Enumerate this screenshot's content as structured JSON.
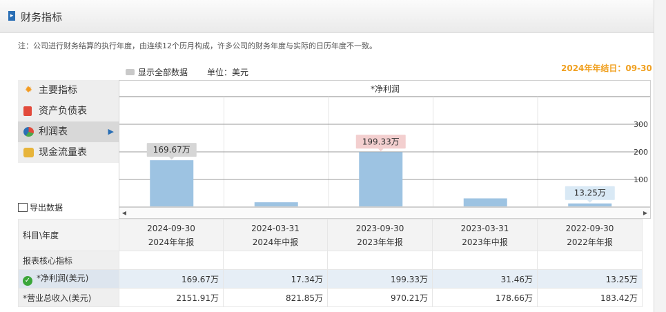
{
  "header": {
    "marker": "▸",
    "title": "财务指标"
  },
  "note": "注：公司进行财务结算的执行年度，由连续12个历月构成，许多公司的财务年度与实际的日历年度不一致。",
  "toolbar": {
    "toggle_label": "显示全部数据",
    "unit_label": "单位：美元",
    "year_end": "2024年年结日：09-30"
  },
  "sidebar": {
    "items": [
      {
        "label": "主要指标",
        "icon": "gear-icon"
      },
      {
        "label": "资产负债表",
        "icon": "document-icon"
      },
      {
        "label": "利润表",
        "icon": "pie-chart-icon"
      },
      {
        "label": "现金流量表",
        "icon": "coins-icon"
      }
    ],
    "export_label": "导出数据"
  },
  "chart_data": {
    "type": "bar",
    "title": "*净利润",
    "categories": [
      "2024-09-30",
      "2024-03-31",
      "2023-09-30",
      "2023-03-31",
      "2022-09-30"
    ],
    "values": [
      169.67,
      17.34,
      199.33,
      31.46,
      13.25
    ],
    "value_unit": "万",
    "ylim": [
      0,
      400
    ],
    "yticks": [
      "100",
      "200",
      "300"
    ],
    "callouts": [
      "169.67万",
      "",
      "199.33万",
      "",
      "13.25万"
    ],
    "callout_colors": [
      "#d6d6d6",
      "",
      "#f3cfcf",
      "",
      "#d9e9f5"
    ],
    "bar_color": "#9dc3e2",
    "grid": true
  },
  "table": {
    "corner": "科目\\年度",
    "columns": [
      {
        "date": "2024-09-30",
        "type": "2024年年报"
      },
      {
        "date": "2024-03-31",
        "type": "2024年中报"
      },
      {
        "date": "2023-09-30",
        "type": "2023年年报"
      },
      {
        "date": "2023-03-31",
        "type": "2023年中报"
      },
      {
        "date": "2022-09-30",
        "type": "2022年年报"
      }
    ],
    "section_title": "报表核心指标",
    "rows": [
      {
        "label": "*净利润(美元)",
        "values": [
          "169.67万",
          "17.34万",
          "199.33万",
          "31.46万",
          "13.25万"
        ]
      },
      {
        "label": "*营业总收入(美元)",
        "values": [
          "2151.91万",
          "821.85万",
          "970.21万",
          "178.66万",
          "183.42万"
        ]
      }
    ]
  }
}
